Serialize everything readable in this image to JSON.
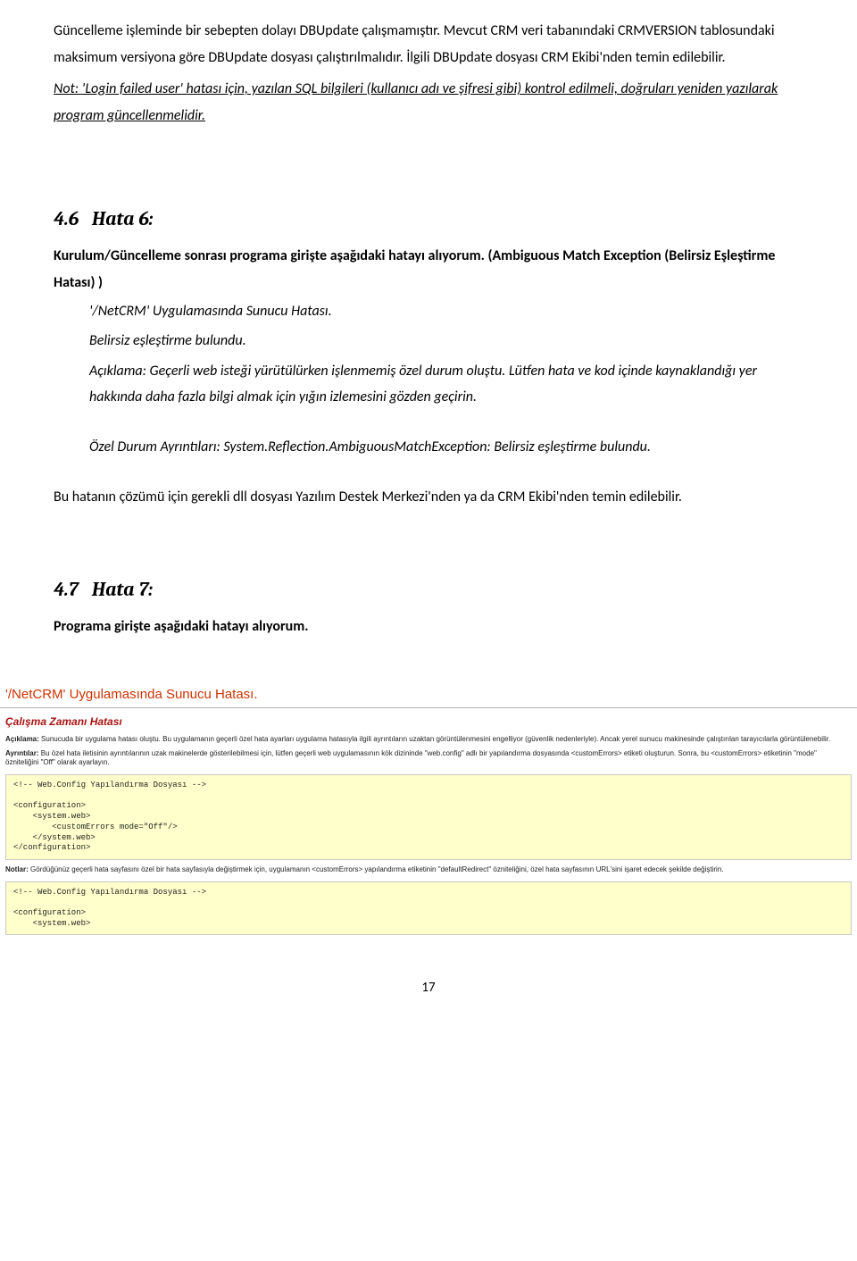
{
  "intro": {
    "p1": "Güncelleme işleminde bir sebepten dolayı DBUpdate çalışmamıştır. Mevcut CRM veri tabanındaki CRMVERSION tablosundaki maksimum versiyona göre DBUpdate dosyası çalıştırılmalıdır. İlgili DBUpdate dosyası CRM Ekibi'nden temin edilebilir.",
    "note": "Not: 'Login failed user' hatası için, yazılan SQL bilgileri (kullanıcı adı ve şifresi gibi) kontrol edilmeli, doğruları yeniden yazılarak program güncellenmelidir."
  },
  "h6": {
    "num": "4.6",
    "title": "Hata 6:",
    "lead1": "Kurulum/Güncelleme sonrası programa girişte aşağıdaki hatayı alıyorum. (Ambiguous Match Exception (Belirsiz Eşleştirme Hatası) )",
    "l1": "'/NetCRM' Uygulamasında Sunucu Hatası.",
    "l2": "Belirsiz eşleştirme bulundu.",
    "l3": "Açıklama: Geçerli web isteği yürütülürken işlenmemiş özel durum oluştu. Lütfen hata ve kod içinde kaynaklandığı yer hakkında daha fazla bilgi almak için yığın izlemesini gözden geçirin.",
    "l4": "Özel Durum Ayrıntıları: System.Reflection.AmbiguousMatchException: Belirsiz eşleştirme bulundu.",
    "sol": "Bu hatanın çözümü için gerekli dll dosyası Yazılım Destek Merkezi'nden ya da CRM Ekibi'nden temin edilebilir."
  },
  "h7": {
    "num": "4.7",
    "title": "Hata 7:",
    "lead": "Programa girişte aşağıdaki hatayı alıyorum."
  },
  "err": {
    "title": "'/NetCRM' Uygulamasında Sunucu Hatası.",
    "runtime": "Çalışma Zamanı Hatası",
    "acik_l": "Açıklama:",
    "acik": "Sunucuda bir uygulama hatası oluştu. Bu uygulamanın geçerli özel hata ayarları uygulama hatasıyla ilgili ayrıntıların uzaktan görüntülenmesini engelliyor (güvenlik nedenleriyle). Ancak yerel sunucu makinesinde çalıştırılan tarayıcılarla görüntülenebilir.",
    "ayr_l": "Ayrıntılar:",
    "ayr": "Bu özel hata iletisinin ayrıntılarının uzak makinelerde gösterilebilmesi için, lütfen geçerli web uygulamasının kök dizininde \"web.config\" adlı bir yapılandırma dosyasında <customErrors> etiketi oluşturun. Sonra, bu <customErrors> etiketinin \"mode\" özniteliğini \"Off\" olarak ayarlayın.",
    "code1": "<!-- Web.Config Yapılandırma Dosyası -->\n\n<configuration>\n    <system.web>\n        <customErrors mode=\"Off\"/>\n    </system.web>\n</configuration>",
    "not_l": "Notlar:",
    "not": "Gördüğünüz geçerli hata sayfasını özel bir hata sayfasıyla değiştirmek için, uygulamanın <customErrors> yapılandırma etiketinin \"defaultRedirect\" özniteliğini, özel hata sayfasının URL'sini işaret edecek şekilde değiştirin.",
    "code2": "<!-- Web.Config Yapılandırma Dosyası -->\n\n<configuration>\n    <system.web>"
  },
  "pageNumber": "17"
}
